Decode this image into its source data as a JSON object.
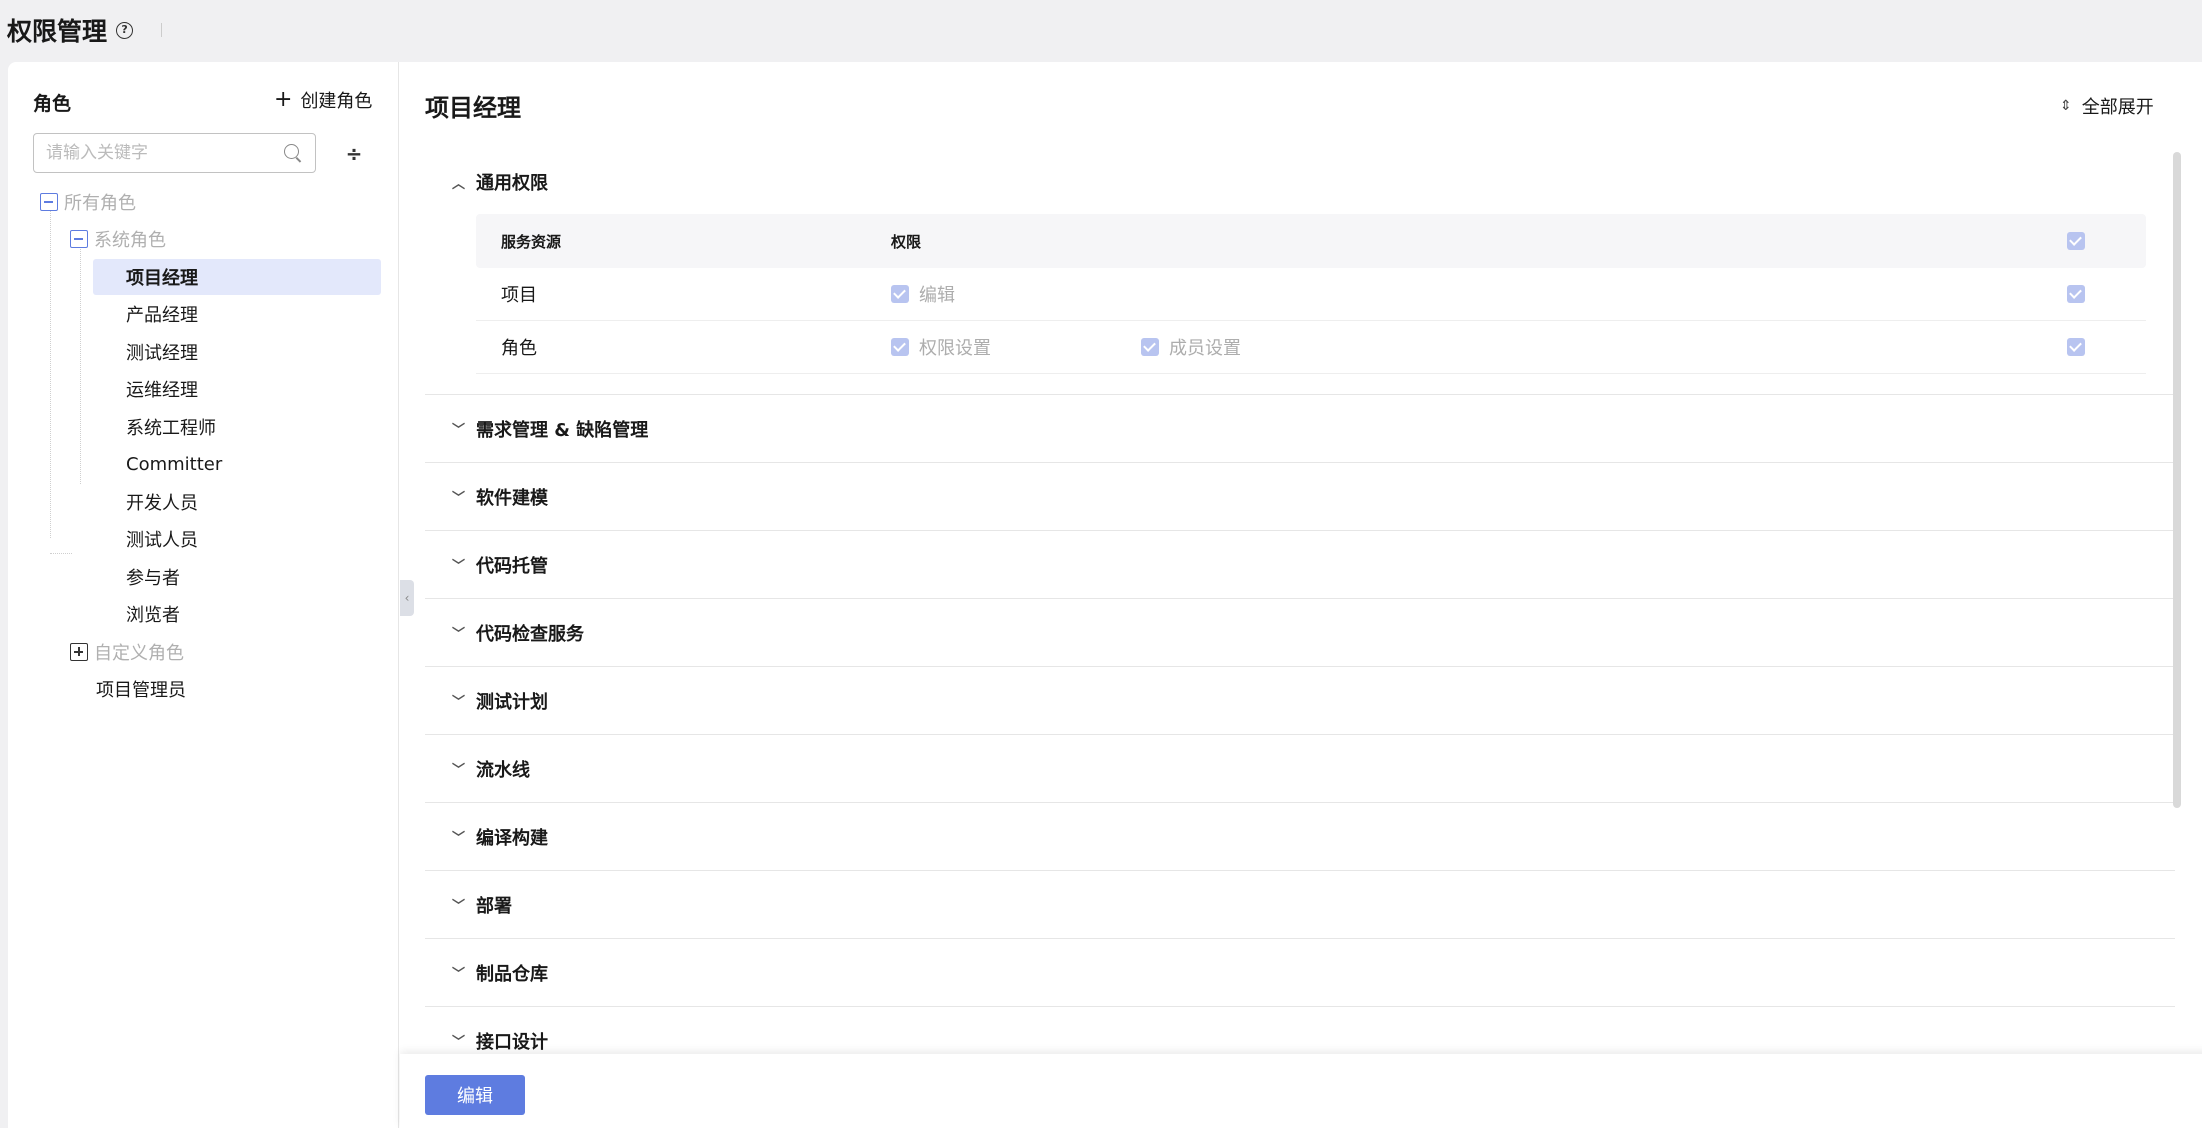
{
  "header": {
    "title": "权限管理",
    "help_icon": "help-circle-icon"
  },
  "sidebar": {
    "title": "角色",
    "create_role_label": "创建角色",
    "search_placeholder": "请输入关键字",
    "tree": {
      "all_roles": "所有角色",
      "system_roles": "系统角色",
      "system_items": [
        "项目经理",
        "产品经理",
        "测试经理",
        "运维经理",
        "系统工程师",
        "Committer",
        "开发人员",
        "测试人员",
        "参与者",
        "浏览者"
      ],
      "selected": "项目经理",
      "custom_roles": "自定义角色",
      "project_admin": "项目管理员"
    }
  },
  "content": {
    "title": "项目经理",
    "expand_all_label": "全部展开",
    "general_group": {
      "label": "通用权限",
      "table_headers": {
        "resource": "服务资源",
        "permission": "权限"
      },
      "rows": [
        {
          "resource": "项目",
          "perms": [
            "编辑"
          ]
        },
        {
          "resource": "角色",
          "perms": [
            "权限设置",
            "成员设置"
          ]
        }
      ]
    },
    "collapsed_groups": [
      "需求管理 & 缺陷管理",
      "软件建模",
      "代码托管",
      "代码检查服务",
      "测试计划",
      "流水线",
      "编译构建",
      "部署",
      "制品仓库",
      "接口设计"
    ]
  },
  "footer": {
    "edit_label": "编辑"
  },
  "colors": {
    "accent": "#5e7ce0",
    "selected_bg": "#e3e8fb",
    "checkbox_disabled": "#b8c4f0"
  }
}
